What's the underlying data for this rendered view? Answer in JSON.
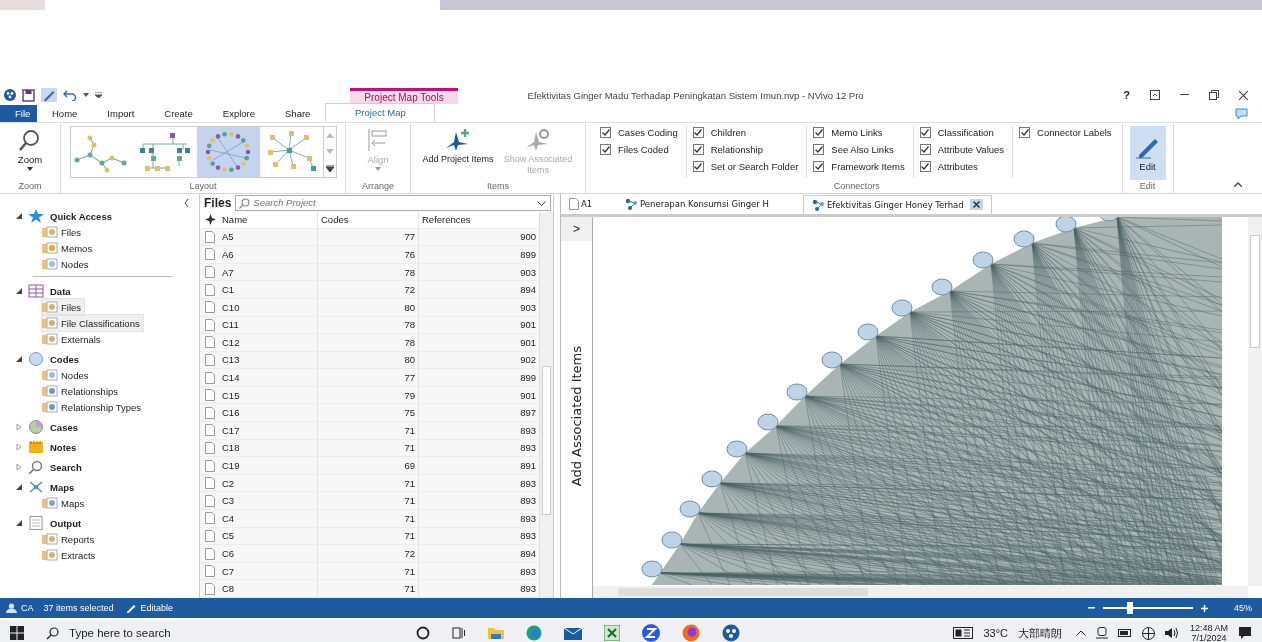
{
  "window": {
    "title": "Efektivitas Ginger Madu Terhadap Peningkatan Sistem Imun.nvp - NVivo 12 Pro",
    "help": "?"
  },
  "contextual_group": "Project Map Tools",
  "ribbon_tabs": [
    {
      "label": "File",
      "kind": "file",
      "selected": false
    },
    {
      "label": "Home",
      "kind": "tab",
      "selected": false
    },
    {
      "label": "Import",
      "kind": "tab",
      "selected": false
    },
    {
      "label": "Create",
      "kind": "tab",
      "selected": false
    },
    {
      "label": "Explore",
      "kind": "tab",
      "selected": false
    },
    {
      "label": "Share",
      "kind": "tab",
      "selected": false
    },
    {
      "label": "Project Map",
      "kind": "context",
      "selected": true
    }
  ],
  "ribbon": {
    "zoom": {
      "label": "Zoom",
      "group": "Zoom"
    },
    "layout": {
      "group": "Layout",
      "options": [
        {
          "kind": "tree",
          "selected": false
        },
        {
          "kind": "hierarchy",
          "selected": false
        },
        {
          "kind": "circle",
          "selected": true
        },
        {
          "kind": "star",
          "selected": false
        }
      ]
    },
    "arrange": {
      "label": "Align",
      "disabled": true,
      "group": "Arrange"
    },
    "items": {
      "group": "Items",
      "buttons": [
        {
          "label": "Add Project Items",
          "kind": "add",
          "disabled": false
        },
        {
          "label": "Show Associated Items",
          "kind": "show",
          "disabled": true
        }
      ]
    },
    "connectors": {
      "group": "Connectors",
      "columns": [
        [
          {
            "label": "Cases Coding",
            "checked": true
          },
          {
            "label": "Files Coded",
            "checked": true
          }
        ],
        [
          {
            "label": "Children",
            "checked": true
          },
          {
            "label": "Relationship",
            "checked": true
          },
          {
            "label": "Set or Search Folder",
            "checked": true
          }
        ],
        [
          {
            "label": "Memo Links",
            "checked": true
          },
          {
            "label": "See Also Links",
            "checked": true
          },
          {
            "label": "Framework Items",
            "checked": true
          }
        ],
        [
          {
            "label": "Classification",
            "checked": true
          },
          {
            "label": "Attribute Values",
            "checked": true
          },
          {
            "label": "Attributes",
            "checked": true
          }
        ],
        [
          {
            "label": "Connector Labels",
            "checked": true
          }
        ]
      ]
    },
    "edit": {
      "label": "Edit",
      "selected": true,
      "group": "Edit"
    }
  },
  "navigation": [
    {
      "label": "Quick Access",
      "kind": "star",
      "expanded": true,
      "children": [
        {
          "label": "Files",
          "kind": "files",
          "selected": false
        },
        {
          "label": "Memos",
          "kind": "memos",
          "selected": false
        },
        {
          "label": "Nodes",
          "kind": "nodes",
          "selected": false
        }
      ]
    },
    {
      "label": "Data",
      "kind": "data",
      "expanded": true,
      "children": [
        {
          "label": "Files",
          "kind": "files",
          "selected": true
        },
        {
          "label": "File Classifications",
          "kind": "classes",
          "selected": true
        },
        {
          "label": "Externals",
          "kind": "files",
          "selected": false
        }
      ]
    },
    {
      "label": "Codes",
      "kind": "codes",
      "expanded": true,
      "children": [
        {
          "label": "Nodes",
          "kind": "nodes",
          "selected": false
        },
        {
          "label": "Relationships",
          "kind": "rel",
          "selected": false
        },
        {
          "label": "Relationship Types",
          "kind": "rel",
          "selected": false
        }
      ]
    },
    {
      "label": "Cases",
      "kind": "cases",
      "expanded": false
    },
    {
      "label": "Notes",
      "kind": "notes",
      "expanded": false
    },
    {
      "label": "Search",
      "kind": "search",
      "expanded": false
    },
    {
      "label": "Maps",
      "kind": "maps",
      "expanded": true,
      "children": [
        {
          "label": "Maps",
          "kind": "maps",
          "selected": false
        }
      ]
    },
    {
      "label": "Output",
      "kind": "output",
      "expanded": true,
      "children": [
        {
          "label": "Reports",
          "kind": "files",
          "selected": false
        },
        {
          "label": "Extracts",
          "kind": "classes",
          "selected": false
        }
      ]
    }
  ],
  "file_list": {
    "title": "Files",
    "search": {
      "placeholder": "Search Project"
    },
    "columns": [
      "Name",
      "Codes",
      "References"
    ],
    "rows": [
      {
        "name": "A5",
        "codes": "77",
        "references": "900"
      },
      {
        "name": "A6",
        "codes": "76",
        "references": "899"
      },
      {
        "name": "A7",
        "codes": "78",
        "references": "903"
      },
      {
        "name": "C1",
        "codes": "72",
        "references": "894"
      },
      {
        "name": "C10",
        "codes": "80",
        "references": "903"
      },
      {
        "name": "C11",
        "codes": "78",
        "references": "901"
      },
      {
        "name": "C12",
        "codes": "78",
        "references": "901"
      },
      {
        "name": "C13",
        "codes": "80",
        "references": "902"
      },
      {
        "name": "C14",
        "codes": "77",
        "references": "899"
      },
      {
        "name": "C15",
        "codes": "79",
        "references": "901"
      },
      {
        "name": "C16",
        "codes": "75",
        "references": "897"
      },
      {
        "name": "C17",
        "codes": "71",
        "references": "893"
      },
      {
        "name": "C18",
        "codes": "71",
        "references": "893"
      },
      {
        "name": "C19",
        "codes": "69",
        "references": "891"
      },
      {
        "name": "C2",
        "codes": "71",
        "references": "893"
      },
      {
        "name": "C3",
        "codes": "71",
        "references": "893"
      },
      {
        "name": "C4",
        "codes": "71",
        "references": "893"
      },
      {
        "name": "C5",
        "codes": "71",
        "references": "893"
      },
      {
        "name": "C6",
        "codes": "72",
        "references": "894"
      },
      {
        "name": "C7",
        "codes": "71",
        "references": "893"
      },
      {
        "name": "C8",
        "codes": "71",
        "references": "893"
      }
    ]
  },
  "document_tabs": [
    {
      "label": "A1",
      "kind": "file",
      "selected": false
    },
    {
      "label": "Penerapan Konsumsi Ginger H",
      "kind": "map",
      "selected": false
    },
    {
      "label": "Efektivitas Ginger Honey Terhad",
      "kind": "map",
      "selected": true
    }
  ],
  "side_panel": {
    "label": "Add Associated Items",
    "expand": ">"
  },
  "status_bar": {
    "user": "CA",
    "selection": "37 items selected",
    "mode": "Editable",
    "zoom": {
      "level": 0.3,
      "reading": "45%"
    }
  },
  "taskbar": {
    "search": {
      "placeholder": "Type here to search"
    },
    "temperature": "33°C",
    "weather": "大部晴朗",
    "time": "12:48 AM",
    "date": "7/1/2024"
  }
}
